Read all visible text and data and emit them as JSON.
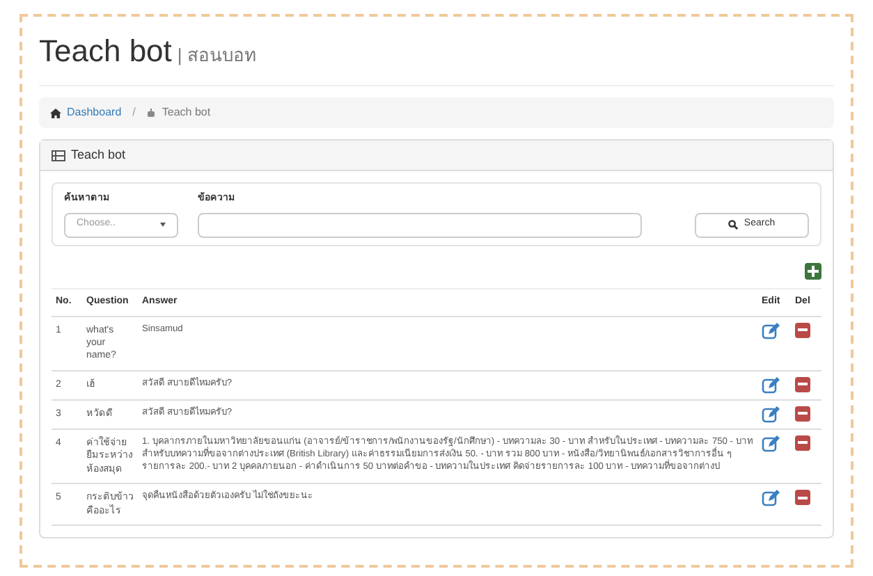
{
  "page": {
    "title": "Teach bot",
    "subtitle": "| สอนบอท"
  },
  "breadcrumb": [
    {
      "label": "Dashboard"
    },
    {
      "label": "Teach bot"
    }
  ],
  "breadcrumb_separator": "/",
  "panel": {
    "title": "Teach bot"
  },
  "search": {
    "filter_label": "ค้นหาตาม",
    "filter_placeholder": "Choose..",
    "text_label": "ข้อความ",
    "button": "Search"
  },
  "table": {
    "columns": [
      "No.",
      "Question",
      "Answer",
      "Edit",
      "Del"
    ],
    "rows": [
      {
        "no": "1",
        "question": "what's your name?",
        "answer": "Sinsamud"
      },
      {
        "no": "2",
        "question": "เฮ้",
        "answer": "สวัสดี สบายดีไหมครับ?"
      },
      {
        "no": "3",
        "question": "หวัดดี",
        "answer": "สวัสดี สบายดีไหมครับ?"
      },
      {
        "no": "4",
        "question": "ค่าใช้จ่ายยืมระหว่างห้องสมุด",
        "answer": "1. บุคลากรภายในมหาวิทยาลัยขอนแก่น (อาจารย์/ข้าราชการ/พนักงานของรัฐ/นักศึกษา) - บทความละ 30 - บาท สำหรับในประเทศ - บทความละ 750 - บาท สำหรับบทความที่ขอจากต่างประเทศ (British Library) และค่าธรรมเนียมการส่งเงิน 50. - บาท รวม 800 บาท - หนังสือ/วิทยานิพนธ์/เอกสารวิชาการอื่น ๆ รายการละ 200.- บาท 2 บุคคลภายนอก - ค่าดำเนินการ 50 บาทต่อคำขอ - บทความในประเทศ คิดจ่ายรายการละ 100 บาท - บทความที่ขอจากต่างป"
      },
      {
        "no": "5",
        "question": "กระติบข้าวคืออะไร",
        "answer": "จุดคืนหนังสือด้วยตัวเองครับ ไม่ใช่ถังขยะนะ"
      }
    ]
  }
}
